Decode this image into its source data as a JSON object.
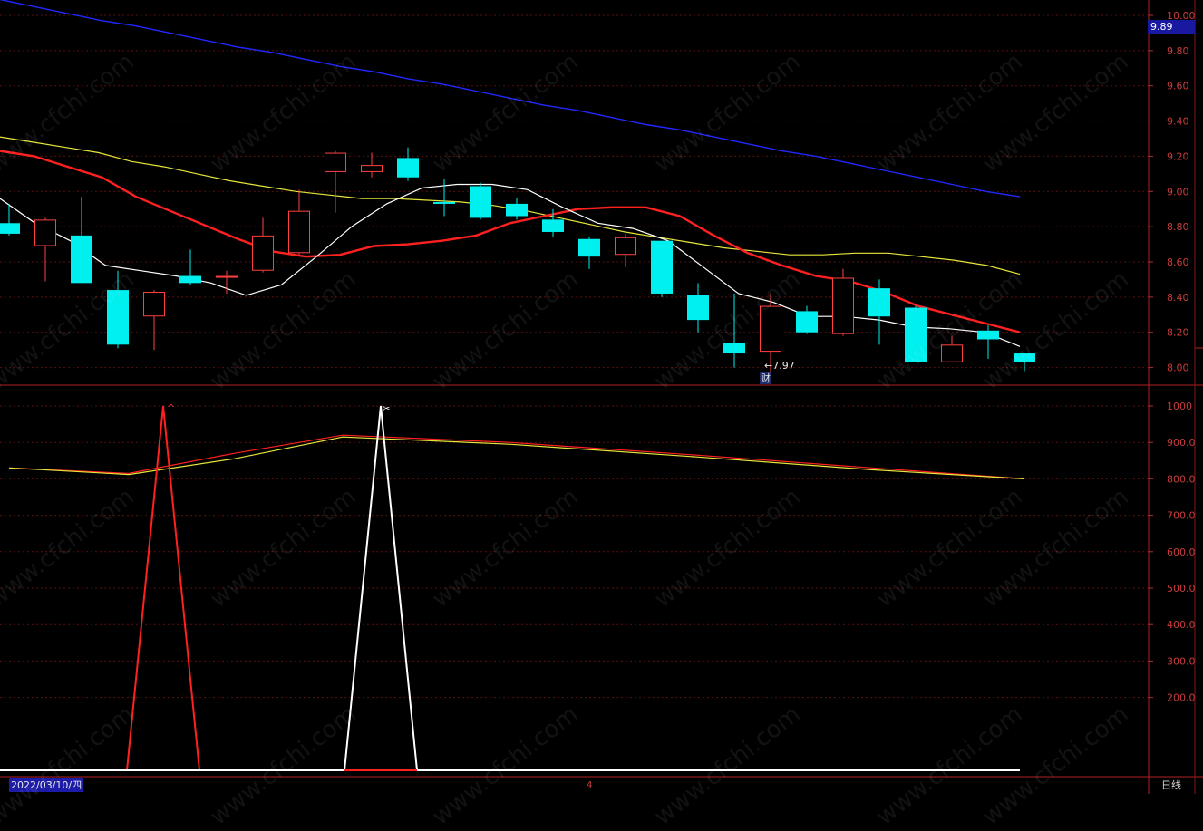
{
  "chart_data": [
    {
      "type": "candlestick",
      "panel": "price",
      "ylim": [
        7.9,
        10.0
      ],
      "yticks": [
        "10.00",
        "9.80",
        "9.60",
        "9.40",
        "9.20",
        "9.00",
        "8.80",
        "8.60",
        "8.40",
        "8.20",
        "8.00"
      ],
      "last_price_badge": "9.89",
      "low_annotation": "←7.97",
      "event_marker": "财",
      "candles": [
        {
          "o": 8.82,
          "h": 8.93,
          "l": 8.75,
          "c": 8.76
        },
        {
          "o": 8.69,
          "h": 8.85,
          "l": 8.49,
          "c": 8.84
        },
        {
          "o": 8.75,
          "h": 8.97,
          "l": 8.48,
          "c": 8.48
        },
        {
          "o": 8.44,
          "h": 8.55,
          "l": 8.11,
          "c": 8.13
        },
        {
          "o": 8.29,
          "h": 8.44,
          "l": 8.1,
          "c": 8.43
        },
        {
          "o": 8.52,
          "h": 8.67,
          "l": 8.47,
          "c": 8.48
        },
        {
          "o": 8.52,
          "h": 8.55,
          "l": 8.42,
          "c": 8.52
        },
        {
          "o": 8.55,
          "h": 8.85,
          "l": 8.54,
          "c": 8.75
        },
        {
          "o": 8.65,
          "h": 9.01,
          "l": 8.64,
          "c": 8.89
        },
        {
          "o": 9.11,
          "h": 9.23,
          "l": 8.88,
          "c": 9.22
        },
        {
          "o": 9.11,
          "h": 9.22,
          "l": 9.08,
          "c": 9.15
        },
        {
          "o": 9.19,
          "h": 9.25,
          "l": 9.06,
          "c": 9.08
        },
        {
          "o": 8.94,
          "h": 9.07,
          "l": 8.86,
          "c": 8.93
        },
        {
          "o": 9.03,
          "h": 9.05,
          "l": 8.84,
          "c": 8.85
        },
        {
          "o": 8.93,
          "h": 8.96,
          "l": 8.84,
          "c": 8.86
        },
        {
          "o": 8.84,
          "h": 8.9,
          "l": 8.74,
          "c": 8.77
        },
        {
          "o": 8.73,
          "h": 8.74,
          "l": 8.56,
          "c": 8.63
        },
        {
          "o": 8.64,
          "h": 8.76,
          "l": 8.57,
          "c": 8.74
        },
        {
          "o": 8.72,
          "h": 8.72,
          "l": 8.4,
          "c": 8.42
        },
        {
          "o": 8.41,
          "h": 8.48,
          "l": 8.2,
          "c": 8.27
        },
        {
          "o": 8.14,
          "h": 8.42,
          "l": 8.0,
          "c": 8.08
        },
        {
          "o": 8.09,
          "h": 8.42,
          "l": 7.97,
          "c": 8.35
        },
        {
          "o": 8.32,
          "h": 8.35,
          "l": 8.19,
          "c": 8.2
        },
        {
          "o": 8.19,
          "h": 8.56,
          "l": 8.18,
          "c": 8.51
        },
        {
          "o": 8.45,
          "h": 8.5,
          "l": 8.13,
          "c": 8.29
        },
        {
          "o": 8.34,
          "h": 8.35,
          "l": 8.03,
          "c": 8.03
        },
        {
          "o": 8.03,
          "h": 8.18,
          "l": 8.03,
          "c": 8.13
        },
        {
          "o": 8.21,
          "h": 8.24,
          "l": 8.05,
          "c": 8.16
        },
        {
          "o": 8.08,
          "h": 8.08,
          "l": 7.98,
          "c": 8.03
        }
      ],
      "series": [
        {
          "color": "#ffffff",
          "values": [
            8.96,
            8.82,
            8.72,
            8.58,
            8.55,
            8.52,
            8.48,
            8.41,
            8.47,
            8.63,
            8.8,
            8.93,
            9.02,
            9.04,
            9.04,
            9.01,
            8.91,
            8.82,
            8.79,
            8.72,
            8.57,
            8.42,
            8.37,
            8.29,
            8.29,
            8.27,
            8.23,
            8.22,
            8.2,
            8.12
          ]
        },
        {
          "color": "#ff2020",
          "values": [
            9.23,
            9.2,
            9.14,
            9.08,
            8.97,
            8.89,
            8.81,
            8.73,
            8.66,
            8.63,
            8.64,
            8.69,
            8.7,
            8.72,
            8.75,
            8.82,
            8.86,
            8.9,
            8.91,
            8.91,
            8.86,
            8.75,
            8.65,
            8.58,
            8.52,
            8.49,
            8.43,
            8.35,
            8.3,
            8.25,
            8.2
          ]
        },
        {
          "color": "#e6e63c",
          "values": [
            9.31,
            9.28,
            9.25,
            9.22,
            9.17,
            9.14,
            9.1,
            9.06,
            9.03,
            9.0,
            8.98,
            8.96,
            8.96,
            8.95,
            8.94,
            8.92,
            8.89,
            8.85,
            8.81,
            8.77,
            8.74,
            8.71,
            8.68,
            8.66,
            8.64,
            8.64,
            8.65,
            8.65,
            8.63,
            8.61,
            8.58,
            8.53
          ]
        },
        {
          "color": "#2028ff",
          "values": [
            10.09,
            10.05,
            10.01,
            9.97,
            9.94,
            9.9,
            9.86,
            9.82,
            9.79,
            9.75,
            9.71,
            9.68,
            9.64,
            9.61,
            9.57,
            9.53,
            9.49,
            9.46,
            9.42,
            9.38,
            9.35,
            9.31,
            9.27,
            9.23,
            9.2,
            9.16,
            9.12,
            9.08,
            9.04,
            9.0,
            8.97
          ]
        }
      ]
    },
    {
      "type": "line",
      "panel": "indicator",
      "ylim": [
        0,
        1010
      ],
      "yticks": [
        "1000",
        "900.0",
        "800.0",
        "700.0",
        "600.0",
        "500.0",
        "400.0",
        "300.0",
        "200.0"
      ],
      "series": [
        {
          "color": "#ff2020",
          "x": [
            0,
            3.3,
            6.2,
            9.2,
            13.8,
            19.0,
            23.8,
            28.0
          ],
          "values": [
            830,
            815,
            870,
            920,
            900,
            865,
            830,
            800
          ]
        },
        {
          "color": "#e6e63c",
          "x": [
            0,
            3.3,
            6.2,
            9.2,
            13.8,
            19.0,
            23.8,
            28.0
          ],
          "values": [
            830,
            812,
            855,
            915,
            895,
            860,
            825,
            800
          ]
        },
        {
          "color": "#ff2020",
          "x": [
            3.25,
            4.25,
            5.25
          ],
          "values": [
            0,
            1000,
            0
          ]
        },
        {
          "color": "#ffffff",
          "x": [
            9.25,
            10.25,
            11.25
          ],
          "values": [
            0,
            1000,
            0
          ]
        }
      ],
      "markers": [
        "^",
        "✂"
      ]
    }
  ],
  "footer": {
    "date": "2022/03/10/四",
    "month_marker": "4",
    "period": "日线"
  },
  "watermark": "www.cfchi.com"
}
